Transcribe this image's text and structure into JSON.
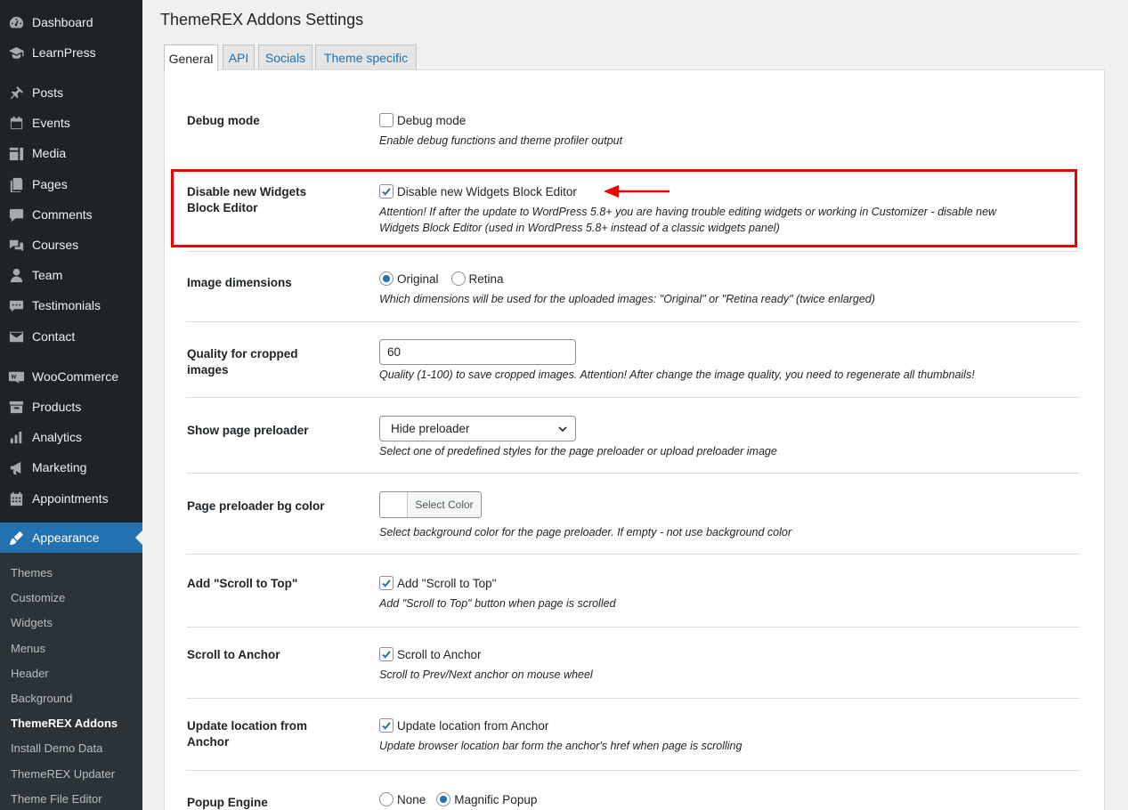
{
  "sidebar": {
    "items": [
      {
        "label": "Dashboard",
        "icon": "dashboard-icon"
      },
      {
        "label": "LearnPress",
        "icon": "graduation-cap-icon"
      },
      {
        "label": "Posts",
        "icon": "pin-icon"
      },
      {
        "label": "Events",
        "icon": "calendar-icon"
      },
      {
        "label": "Media",
        "icon": "media-icon"
      },
      {
        "label": "Pages",
        "icon": "pages-icon"
      },
      {
        "label": "Comments",
        "icon": "comment-icon"
      },
      {
        "label": "Courses",
        "icon": "courses-icon"
      },
      {
        "label": "Team",
        "icon": "person-icon"
      },
      {
        "label": "Testimonials",
        "icon": "testimonial-icon"
      },
      {
        "label": "Contact",
        "icon": "envelope-icon"
      },
      {
        "label": "WooCommerce",
        "icon": "woo-icon"
      },
      {
        "label": "Products",
        "icon": "archive-icon"
      },
      {
        "label": "Analytics",
        "icon": "bar-chart-icon"
      },
      {
        "label": "Marketing",
        "icon": "megaphone-icon"
      },
      {
        "label": "Appointments",
        "icon": "calendar-grid-icon"
      },
      {
        "label": "Appearance",
        "icon": "paintbrush-icon"
      }
    ],
    "submenu": [
      "Themes",
      "Customize",
      "Widgets",
      "Menus",
      "Header",
      "Background",
      "ThemeREX Addons",
      "Install Demo Data",
      "ThemeREX Updater",
      "Theme File Editor"
    ]
  },
  "page": {
    "title": "ThemeREX Addons Settings",
    "tabs": [
      "General",
      "API",
      "Socials",
      "Theme specific"
    ]
  },
  "settings": {
    "debug": {
      "label": "Debug mode",
      "control": "Debug mode",
      "desc": "Enable debug functions and theme profiler output"
    },
    "widgets": {
      "label_1": "Disable new Widgets",
      "label_2": "Block Editor",
      "control": "Disable new Widgets Block Editor",
      "desc_1": "Attention! If after the update to WordPress 5.8+ you are having trouble editing widgets or working in Customizer - disable new",
      "desc_2": "Widgets Block Editor (used in WordPress 5.8+ instead of a classic widgets panel)"
    },
    "image_dims": {
      "label": "Image dimensions",
      "opt_1": "Original",
      "opt_2": "Retina",
      "desc": "Which dimensions will be used for the uploaded images: \"Original\" or \"Retina ready\" (twice enlarged)"
    },
    "quality": {
      "label_1": "Quality for cropped",
      "label_2": "images",
      "value": "60",
      "desc": "Quality (1-100) to save cropped images. Attention! After change the image quality, you need to regenerate all thumbnails!"
    },
    "preloader": {
      "label": "Show page preloader",
      "selected": "Hide preloader",
      "desc": "Select one of predefined styles for the page preloader or upload preloader image"
    },
    "preloader_color": {
      "label": "Page preloader bg color",
      "button": "Select Color",
      "desc": "Select background color for the page preloader. If empty - not use background color"
    },
    "scroll_top": {
      "label": "Add \"Scroll to Top\"",
      "control": "Add \"Scroll to Top\"",
      "desc": "Add \"Scroll to Top\" button when page is scrolled"
    },
    "scroll_anchor": {
      "label": "Scroll to Anchor",
      "control": "Scroll to Anchor",
      "desc": "Scroll to Prev/Next anchor on mouse wheel"
    },
    "update_location": {
      "label_1": "Update location from",
      "label_2": "Anchor",
      "control": "Update location from Anchor",
      "desc": "Update browser location bar form the anchor's href when page is scrolling"
    },
    "popup": {
      "label": "Popup Engine",
      "opt_1": "None",
      "opt_2": "Magnific Popup"
    }
  },
  "colors": {
    "accent": "#2271b1",
    "sidebar": "#1d2327",
    "highlight": "#e00000"
  }
}
